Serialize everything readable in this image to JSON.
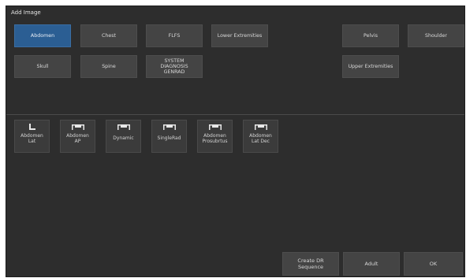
{
  "dialog": {
    "title": "Add Image"
  },
  "categories": {
    "selected": "Abdomen",
    "row1": [
      "Abdomen",
      "Chest",
      "FLFS",
      "Lower Extremities",
      "Pelvis",
      "Shoulder"
    ],
    "row2": [
      "Skull",
      "Spine",
      "SYSTEM\nDIAGNOSIS\nGENRAD",
      "Upper Extremities"
    ]
  },
  "views": [
    {
      "label": "Abdomen\nLat",
      "icon": "lateral-view-icon"
    },
    {
      "label": "Abdomen\nAP",
      "icon": "table-view-icon"
    },
    {
      "label": "Dynamic",
      "icon": "table-view-icon"
    },
    {
      "label": "SingleRad",
      "icon": "table-view-icon"
    },
    {
      "label": "Abdomen\nProsubrtus",
      "icon": "table-view-icon"
    },
    {
      "label": "Abdomen\nLat Dec",
      "icon": "table-view-icon"
    }
  ],
  "footer": {
    "create_dr_sequence": "Create DR\nSequence",
    "adult": "Adult",
    "ok": "OK"
  },
  "colors": {
    "background": "#2d2d2d",
    "button": "#444444",
    "selected": "#2b5e93"
  }
}
